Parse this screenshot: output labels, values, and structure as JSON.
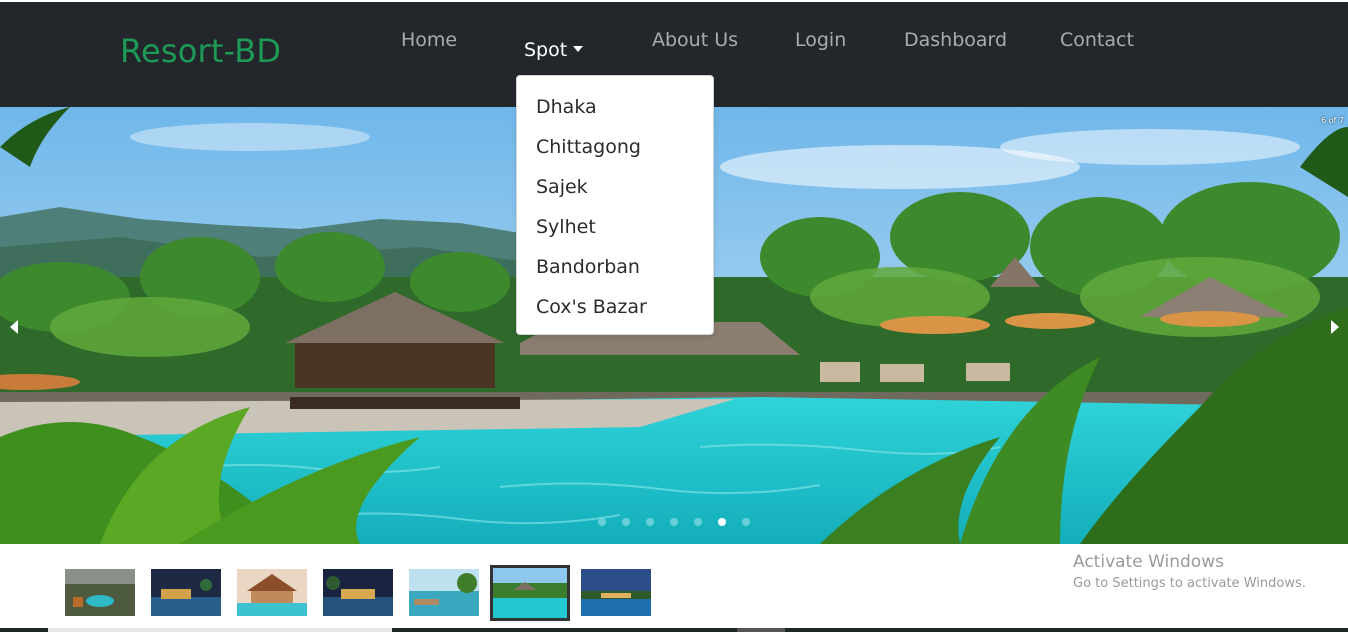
{
  "brand": {
    "name": "Resort-BD",
    "color": "#1e9a57"
  },
  "nav": {
    "home": "Home",
    "spot": "Spot",
    "about": "About Us",
    "login": "Login",
    "dashboard": "Dashboard",
    "contact": "Contact"
  },
  "spot_dropdown": {
    "items": [
      "Dhaka",
      "Chittagong",
      "Sajek",
      "Sylhet",
      "Bandorban",
      "Cox's Bazar"
    ]
  },
  "carousel": {
    "counter": "6 of 7",
    "total_slides": 7,
    "active_slide": 6,
    "prev_icon": "chevron-left-icon",
    "next_icon": "chevron-right-icon"
  },
  "thumbnails": {
    "count": 7,
    "selected": 6
  },
  "watermark": {
    "title": "Activate Windows",
    "subtitle": "Go to Settings to activate Windows."
  },
  "colors": {
    "navbar": "#23272b",
    "pool": "#22c7cf",
    "sky": "#8ec8ef"
  }
}
